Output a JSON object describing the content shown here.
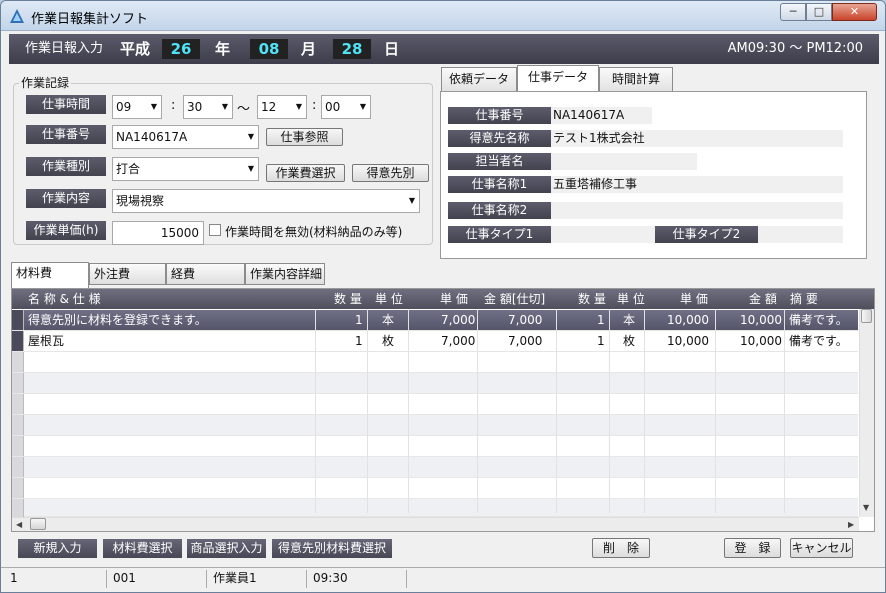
{
  "window": {
    "title": "作業日報集計ソフト",
    "min_label": "─",
    "max_label": "□",
    "close_label": "✕"
  },
  "header": {
    "label": "作業日報入力",
    "era": "平成",
    "year": "26",
    "year_unit": "年",
    "month": "08",
    "month_unit": "月",
    "day": "28",
    "day_unit": "日",
    "time_range": "AM09:30 〜 PM12:00"
  },
  "record": {
    "group_title": "作業記録",
    "work_time_label": "仕事時間",
    "start_hour": "09",
    "start_minute": "30",
    "tilde": "〜",
    "end_hour": "12",
    "end_minute": "00",
    "colon": ":",
    "job_no_label": "仕事番号",
    "job_no_value": "NA140617A",
    "job_ref_button": "仕事参照",
    "work_type_label": "作業種別",
    "work_type_value": "打合",
    "cost_select_button": "作業費選択",
    "client_button": "得意先別",
    "content_label": "作業内容",
    "content_value": "現場視察",
    "unit_price_label": "作業単価(h)",
    "unit_price_value": "15000",
    "disable_time_label": "作業時間を無効(材料納品のみ等)"
  },
  "right_tabs": [
    "依頼データ",
    "仕事データ",
    "時間計算"
  ],
  "job_data": {
    "job_no_label": "仕事番号",
    "job_no_value": "NA140617A",
    "client_label": "得意先名称",
    "client_value": "テスト1株式会社",
    "person_label": "担当者名",
    "person_value": "",
    "name1_label": "仕事名称1",
    "name1_value": "五重塔補修工事",
    "name2_label": "仕事名称2",
    "name2_value": "",
    "type1_label": "仕事タイプ1",
    "type1_value": "",
    "type2_label": "仕事タイプ2",
    "type2_value": ""
  },
  "bottom_tabs": [
    "材料費",
    "外注費",
    "経費",
    "作業内容詳細"
  ],
  "grid": {
    "headers": [
      "名 称 & 仕 様",
      "数 量",
      "単 位",
      "単 価",
      "金 額[仕切]",
      "数 量",
      "単 位",
      "単 価",
      "金 額",
      "摘 要"
    ],
    "rows": [
      [
        "得意先別に材料を登録できます。",
        "1",
        "本",
        "7,000",
        "7,000",
        "1",
        "本",
        "10,000",
        "10,000",
        "備考です。"
      ],
      [
        "屋根瓦",
        "1",
        "枚",
        "7,000",
        "7,000",
        "1",
        "枚",
        "10,000",
        "10,000",
        "備考です。"
      ]
    ]
  },
  "actions": {
    "new_entry": "新規入力",
    "material_select": "材料費選択",
    "product_select": "商品選択入力",
    "client_material_select": "得意先別材料費選択",
    "delete": "削　除",
    "register": "登　録",
    "cancel": "キャンセル"
  },
  "status": {
    "field1": "1",
    "field2": "001",
    "field3": "作業員1",
    "field4": "09:30"
  },
  "colors": {
    "header_bg": "#4a4a58",
    "date_digits": "#4fe3f6",
    "label_bg": "#4f4f5d"
  }
}
